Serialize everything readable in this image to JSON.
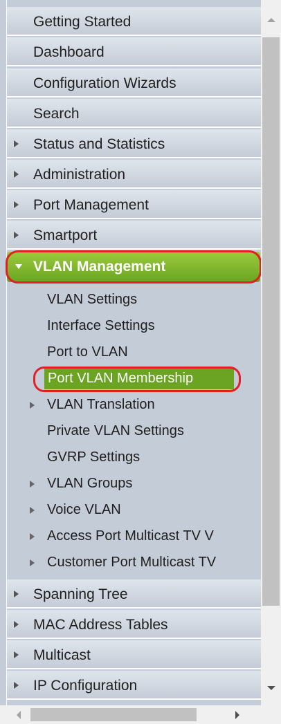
{
  "nav": {
    "top_items": [
      {
        "label": "Getting Started"
      },
      {
        "label": "Dashboard"
      },
      {
        "label": "Configuration Wizards"
      },
      {
        "label": "Search"
      },
      {
        "label": "Status and Statistics"
      },
      {
        "label": "Administration"
      },
      {
        "label": "Port Management"
      },
      {
        "label": "Smartport"
      }
    ],
    "expanded": {
      "label": "VLAN Management",
      "children": [
        {
          "label": "VLAN Settings"
        },
        {
          "label": "Interface Settings"
        },
        {
          "label": "Port to VLAN"
        },
        {
          "label": "Port VLAN Membership"
        },
        {
          "label": "VLAN Translation"
        },
        {
          "label": "Private VLAN Settings"
        },
        {
          "label": "GVRP Settings"
        },
        {
          "label": "VLAN Groups"
        },
        {
          "label": "Voice VLAN"
        },
        {
          "label": "Access Port Multicast TV V"
        },
        {
          "label": "Customer Port Multicast TV"
        }
      ]
    },
    "bottom_items": [
      {
        "label": "Spanning Tree"
      },
      {
        "label": "MAC Address Tables"
      },
      {
        "label": "Multicast"
      },
      {
        "label": "IP Configuration"
      }
    ]
  },
  "colors": {
    "accent_green": "#6aa422",
    "highlight_red": "#e01f26",
    "nav_bg": "#c4ccd8"
  },
  "icons": {
    "collapsed": "caret-right-icon",
    "expanded": "caret-down-icon"
  }
}
